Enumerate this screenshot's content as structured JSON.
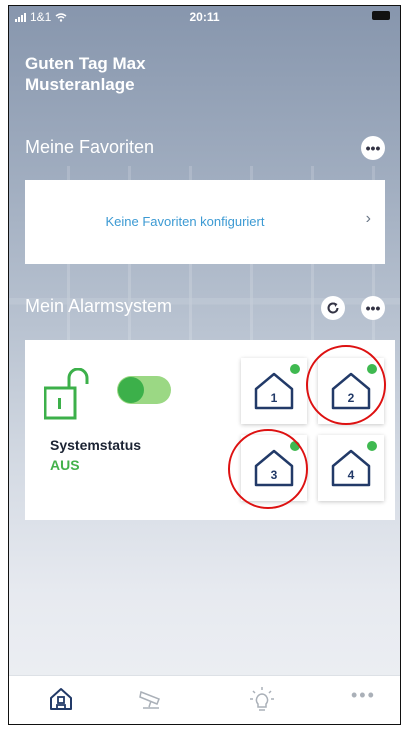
{
  "status_bar": {
    "carrier": "1&1",
    "time": "20:11"
  },
  "header": {
    "greeting": "Guten Tag Max",
    "installation": "Musteranlage"
  },
  "favorites": {
    "title": "Meine Favoriten",
    "more_label": "•••",
    "empty_text": "Keine Favoriten konfiguriert",
    "chevron": "›"
  },
  "alarm": {
    "title": "Mein Alarmsystem",
    "more_label": "•••",
    "status_label": "Systemstatus",
    "status_value": "AUS",
    "zones": [
      {
        "number": "1"
      },
      {
        "number": "2"
      },
      {
        "number": "3"
      },
      {
        "number": "4"
      }
    ]
  },
  "tabs": [
    {
      "icon": "home-icon"
    },
    {
      "icon": "camera-icon"
    },
    {
      "icon": "lightbulb-icon"
    },
    {
      "icon": "more-icon",
      "label": "•••"
    }
  ],
  "colors": {
    "accent_green": "#3cb04a",
    "link_blue": "#3c9ad3",
    "highlight_red": "#d11111"
  }
}
